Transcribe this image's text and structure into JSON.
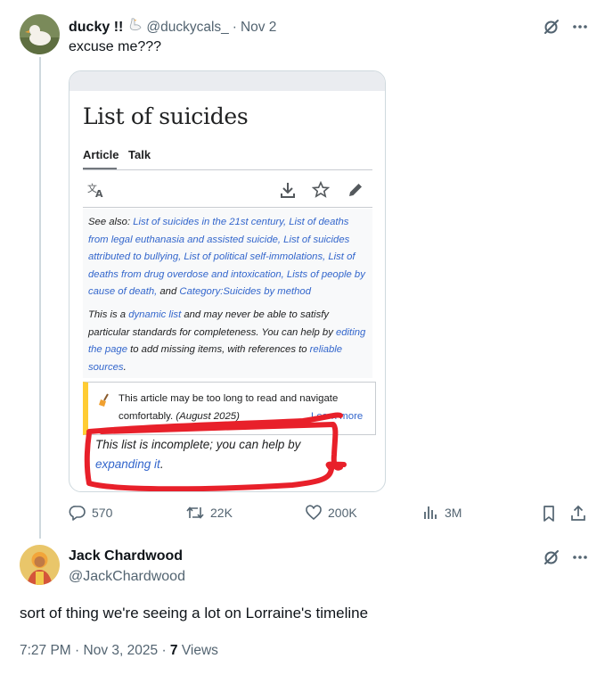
{
  "tweet1": {
    "display_name": "ducky !!",
    "handle": "@duckycals_",
    "separator": "·",
    "date": "Nov 2",
    "text": "excuse me???",
    "actions": {
      "replies": "570",
      "retweets": "22K",
      "likes": "200K",
      "views": "3M"
    }
  },
  "embedded_page": {
    "page_title": "List of suicides",
    "tab_article": "Article",
    "tab_talk": "Talk",
    "see_also_label": "See also: ",
    "see_also_links": "List of suicides in the 21st century, List of deaths from legal euthanasia and assisted suicide, List of suicides attributed to bullying, List of political self-immolations, List of deaths from drug overdose and intoxication, Lists of people by cause of death,",
    "see_also_and": " and ",
    "see_also_last": "Category:Suicides by method",
    "dynamic_1": "This is a ",
    "dynamic_link": "dynamic list",
    "dynamic_2": " and may never be able to satisfy particular standards for completeness. You can help by ",
    "dynamic_link2": "editing the page",
    "dynamic_3": " to add missing items, with references to ",
    "dynamic_link3": "reliable sources",
    "dynamic_4": ".",
    "box_text": "This article may be too long to read and navigate comfortably.",
    "box_date": "(August 2025)",
    "box_link": "Learn more",
    "incomplete_text": "This list is incomplete; you can help by ",
    "incomplete_link": "expanding it",
    "incomplete_end": "."
  },
  "tweet2": {
    "display_name": "Jack Chardwood",
    "handle": "@JackChardwood",
    "text": "sort of thing we're seeing a lot on Lorraine's timeline",
    "time": "7:27 PM",
    "separator": "·",
    "date": "Nov 3, 2025",
    "separator2": "·",
    "views_count": "7",
    "views_label": " Views"
  },
  "colors": {
    "accent": "#1d9bf0",
    "muted": "#536471",
    "wiki_link": "#3366cc",
    "annotation_red": "#e8202a"
  },
  "icons": [
    "grok-icon",
    "more-icon",
    "reply-icon",
    "retweet-icon",
    "like-icon",
    "views-icon",
    "bookmark-icon",
    "share-icon",
    "translate-icon",
    "download-icon",
    "star-icon",
    "edit-icon",
    "broom-icon"
  ]
}
